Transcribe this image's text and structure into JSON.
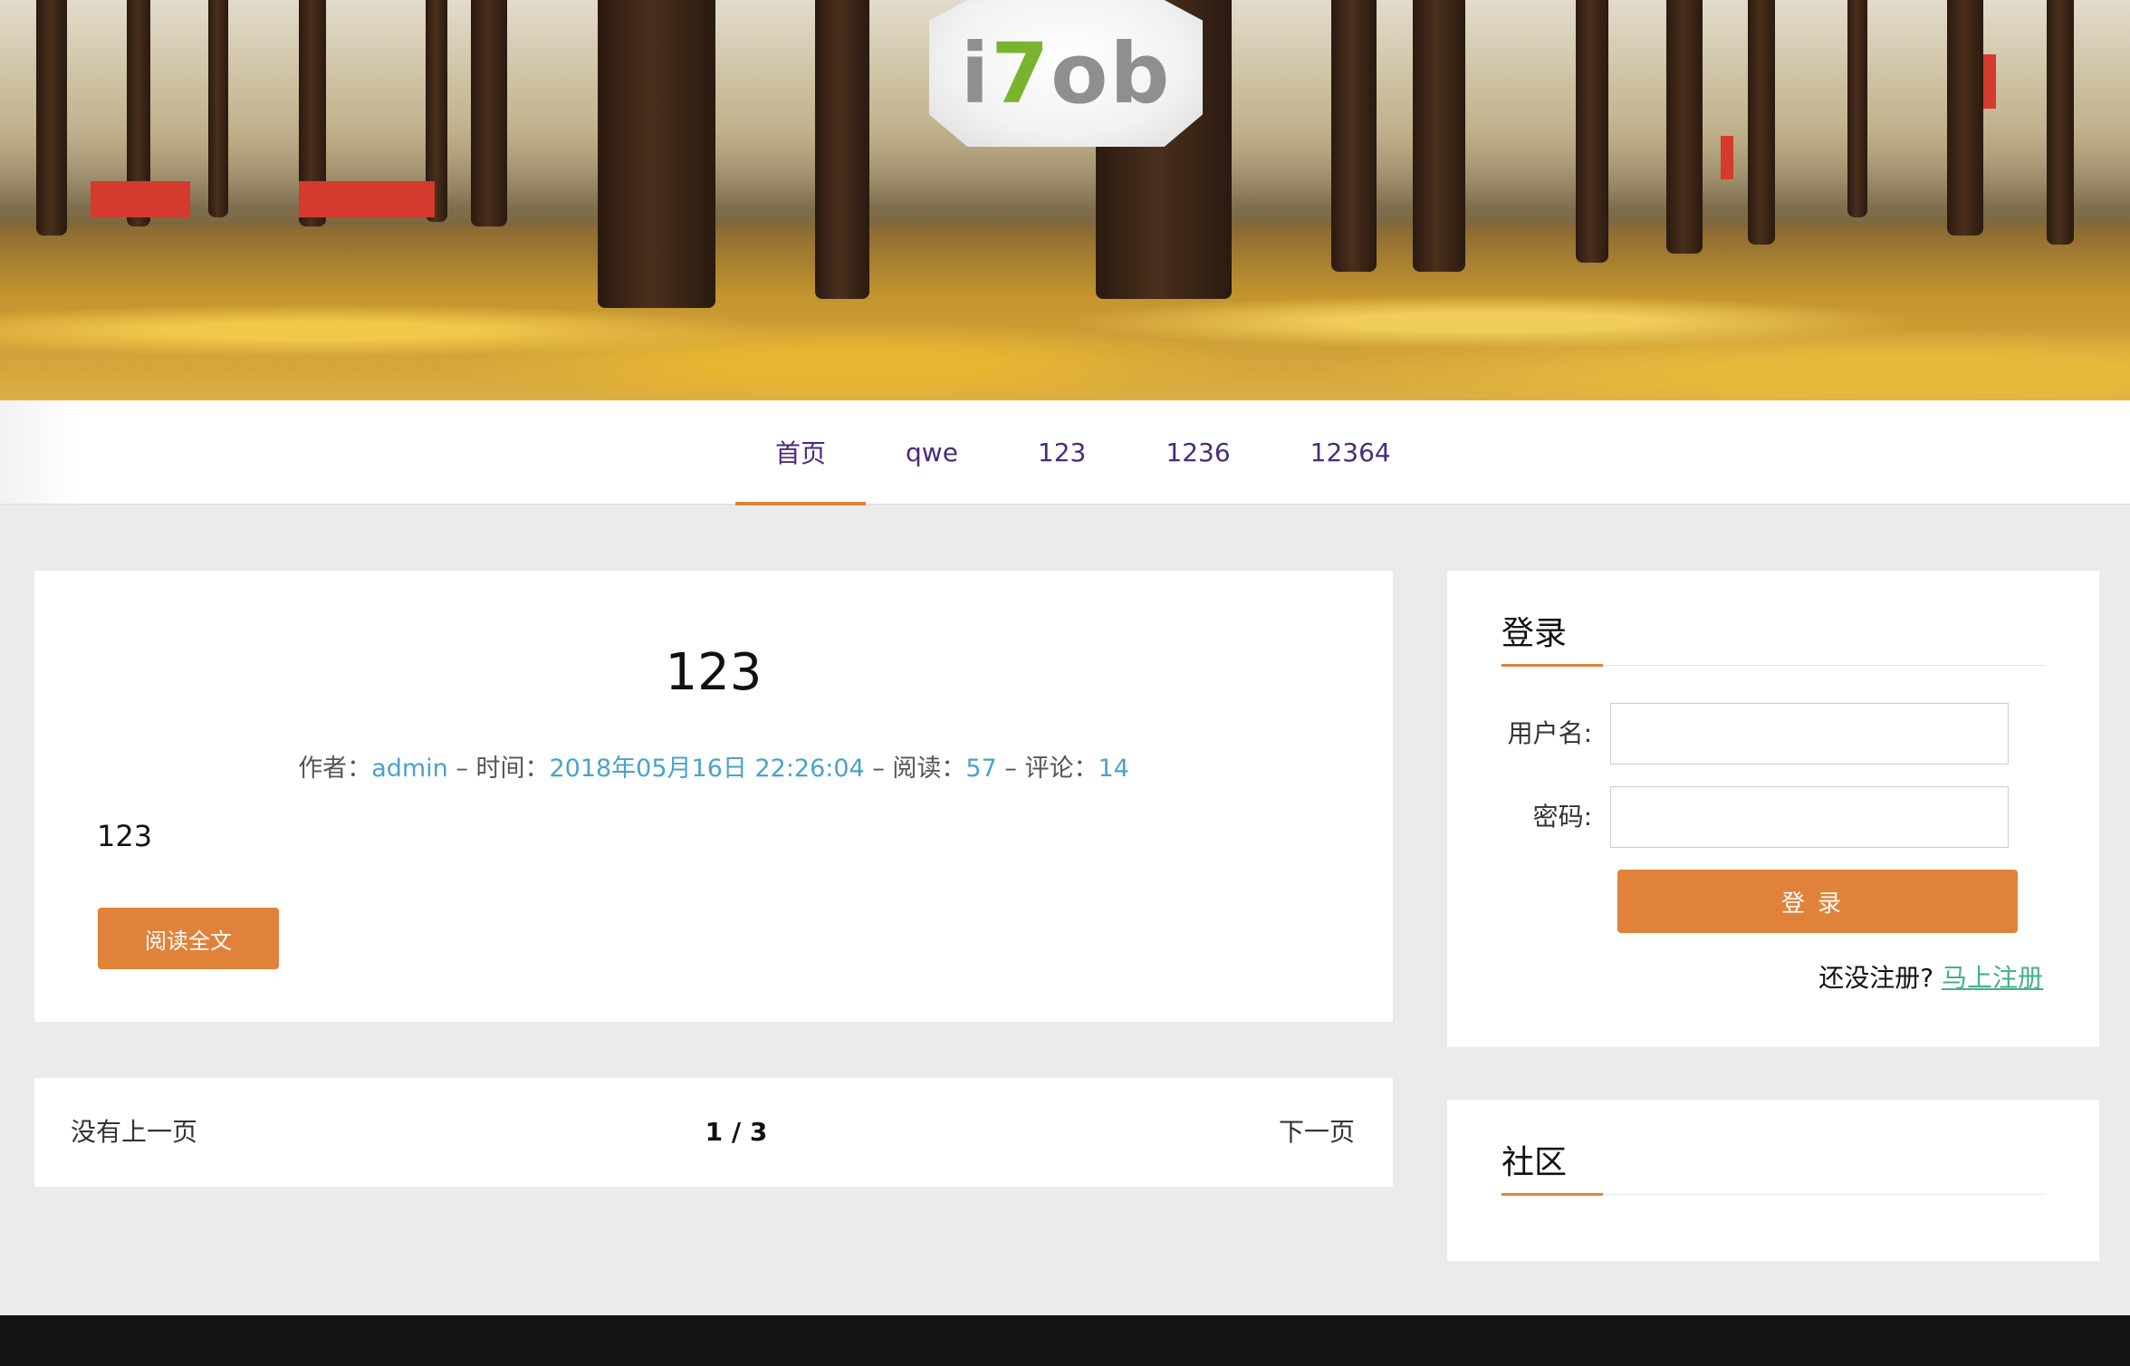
{
  "logo": {
    "text_prefix": "i",
    "text_accent": "7",
    "text_suffix": "ob"
  },
  "nav": {
    "items": [
      {
        "label": "首页",
        "active": true
      },
      {
        "label": "qwe"
      },
      {
        "label": "123"
      },
      {
        "label": "1236"
      },
      {
        "label": "12364"
      }
    ]
  },
  "post": {
    "title": "123",
    "meta": {
      "author_label": "作者：",
      "author": "admin",
      "sep1": " – ",
      "time_label": "时间：",
      "time": "2018年05月16日 22:26:04",
      "sep2": " – ",
      "reads_label": "阅读：",
      "reads": "57",
      "sep3": " – ",
      "comments_label": "评论：",
      "comments": "14"
    },
    "excerpt": "123",
    "read_more": "阅读全文"
  },
  "pager": {
    "prev": "没有上一页",
    "page": "1 / 3",
    "next": "下一页"
  },
  "login": {
    "title": "登录",
    "username_label": "用户名:",
    "password_label": "密码:",
    "username_value": "",
    "password_value": "",
    "submit": "登录",
    "register_prompt": "还没注册?",
    "register_link": "马上注册"
  },
  "community": {
    "title": "社区"
  },
  "colors": {
    "accent": "#e0823a",
    "link": "#4aa3c8",
    "nav_text": "#4b2a7b",
    "register_link": "#45b08a"
  }
}
